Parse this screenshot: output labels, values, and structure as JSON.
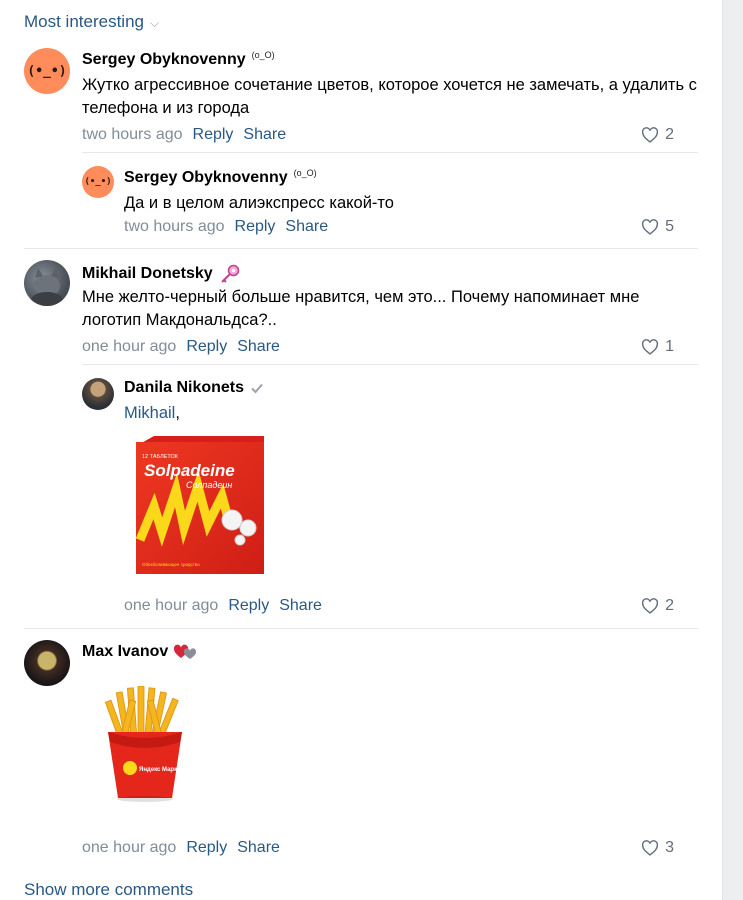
{
  "sort": {
    "label": "Most interesting"
  },
  "comments": [
    {
      "author": "Sergey Obyknovenny",
      "author_emoticon": "(o_O)",
      "avatar_text": "(•_•)",
      "text": "Жутко агрессивное сочетание цветов, которое хочется не замечать, а удалить с телефона и из города",
      "time": "two hours ago",
      "likes": "2"
    },
    {
      "author": "Sergey Obyknovenny",
      "author_emoticon": "(o_O)",
      "avatar_text": "(•_•)",
      "text": "Да и в целом алиэкспресс какой-то",
      "time": "two hours ago",
      "likes": "5"
    },
    {
      "author": "Mikhail Donetsky",
      "text": "Мне желто-черный больше нравится, чем это... Почему напоминает мне логотип Макдональдса?..",
      "time": "one hour ago",
      "likes": "1"
    },
    {
      "author": "Danila Nikonets",
      "mention": "Mikhail",
      "mention_suffix": ",",
      "image": {
        "brand": "Solpadeine",
        "brand_sub": "Солпадеин",
        "tag": "12 ТАБЛЕТОК",
        "bottom": "Обезболивающее средство"
      },
      "time": "one hour ago",
      "likes": "2"
    },
    {
      "author": "Max Ivanov",
      "image": {
        "brand": "Яндекс Маркет"
      },
      "time": "one hour ago",
      "likes": "3"
    }
  ],
  "actions": {
    "reply": "Reply",
    "share": "Share"
  },
  "footer": {
    "show_more": "Show more comments"
  },
  "colors": {
    "link": "#2a5885",
    "meta": "#818c99",
    "accent_red": "#e4261b",
    "accent_yellow": "#fbd81a"
  }
}
